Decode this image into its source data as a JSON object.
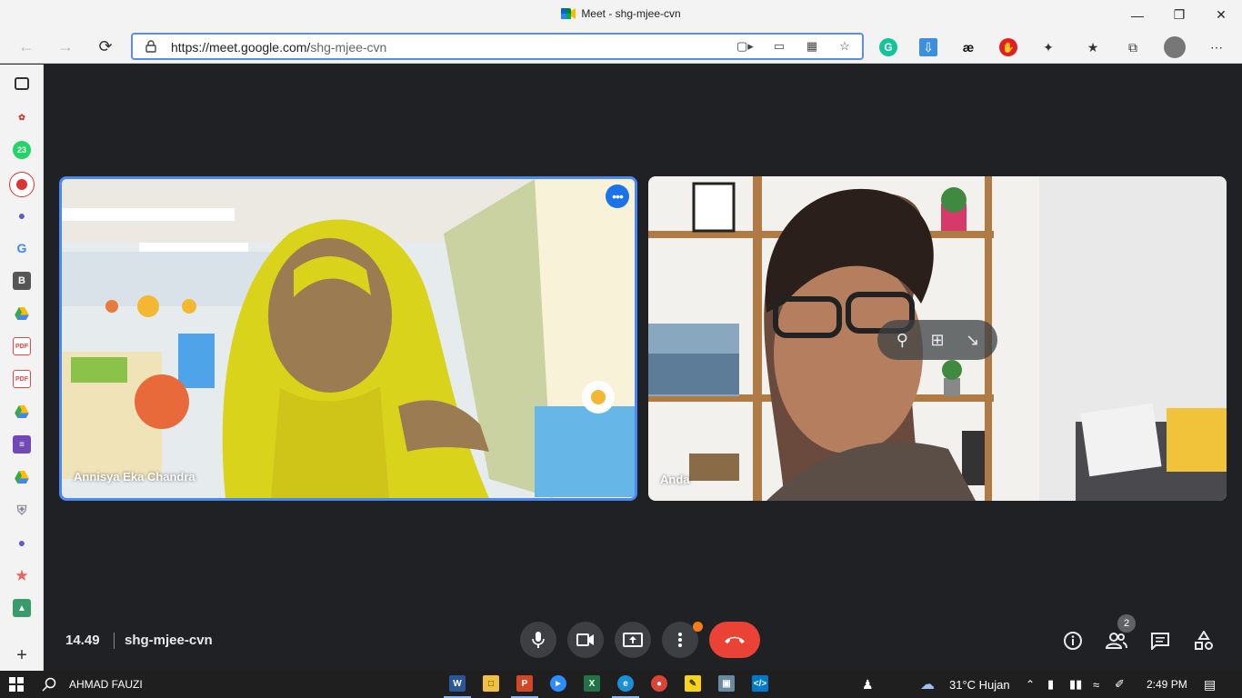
{
  "window": {
    "title": "Meet - shg-mjee-cvn",
    "controls": [
      "minimize",
      "maximize",
      "close"
    ]
  },
  "browser": {
    "url_host": "https://meet.google.com/",
    "url_path": "shg-mjee-cvn",
    "extensions": [
      "grammarly-icon",
      "download-icon",
      "ae-icon",
      "adblock-icon",
      "puzzle-icon",
      "favorites-icon",
      "collections-icon",
      "profile-avatar",
      "more-icon"
    ]
  },
  "sidebar": {
    "items": [
      "tab-actions",
      "app-1",
      "whatsapp",
      "screen-recorder",
      "teams",
      "google",
      "app-b",
      "drive",
      "pdf-1",
      "pdf-2",
      "drive-2",
      "forms",
      "drive-3",
      "app-shield",
      "teams-2",
      "wifi-app",
      "app-green"
    ]
  },
  "meet": {
    "participants": [
      {
        "name": "Annisya Eka Chandra"
      },
      {
        "name": "Anda"
      }
    ],
    "time": "14.49",
    "meeting_code": "shg-mjee-cvn",
    "participant_count": "2"
  },
  "taskbar": {
    "user": "AHMAD FAUZI",
    "weather": "31°C  Hujan",
    "time": "2:49 PM"
  },
  "colors": {
    "accent": "#1a73e8",
    "end_call": "#ea4335",
    "meet_bg": "#202124"
  }
}
